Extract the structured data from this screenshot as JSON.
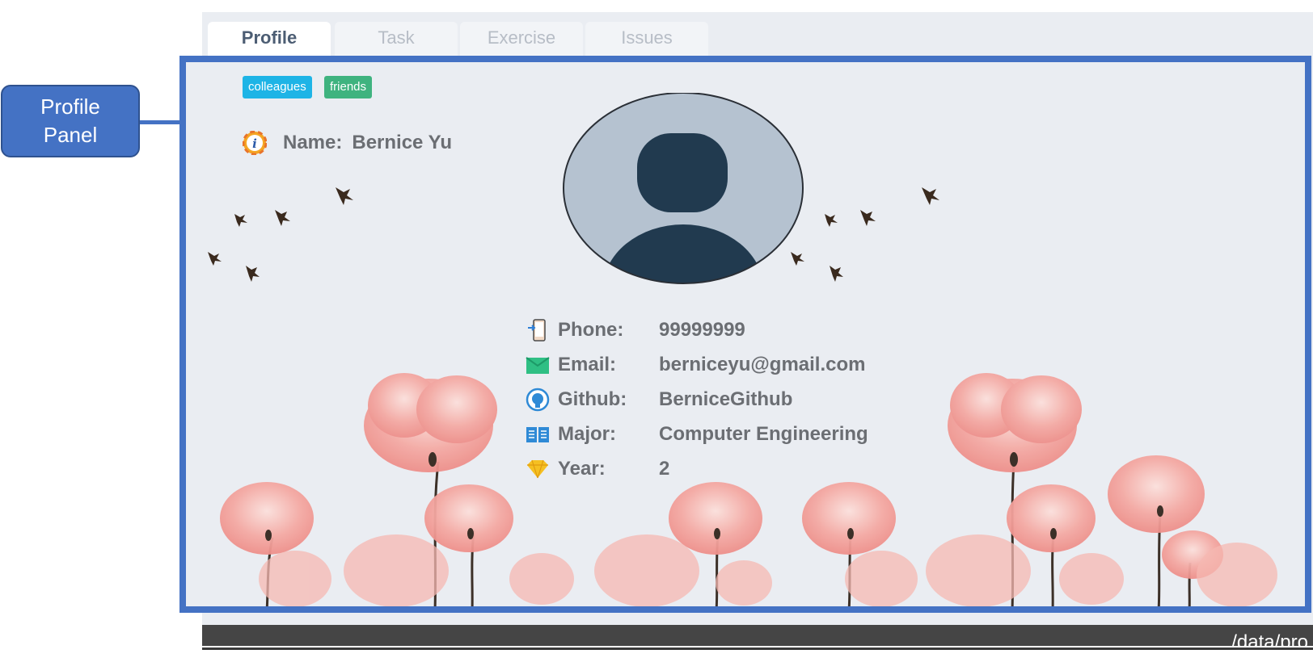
{
  "callout": {
    "line1": "Profile",
    "line2": "Panel"
  },
  "tabs": [
    {
      "label": "Profile",
      "active": true
    },
    {
      "label": "Task",
      "active": false
    },
    {
      "label": "Exercise",
      "active": false
    },
    {
      "label": "Issues",
      "active": false
    }
  ],
  "tags": [
    {
      "label": "colleagues",
      "color": "#1eb4e6"
    },
    {
      "label": "friends",
      "color": "#3fb37f"
    }
  ],
  "profile": {
    "name_label": "Name:",
    "name_value": "Bernice Yu",
    "fields": [
      {
        "icon": "phone-icon",
        "label": "Phone:",
        "value": "99999999"
      },
      {
        "icon": "email-icon",
        "label": "Email:",
        "value": "berniceyu@gmail.com"
      },
      {
        "icon": "github-icon",
        "label": "Github:",
        "value": "BerniceGithub"
      },
      {
        "icon": "book-icon",
        "label": "Major:",
        "value": "Computer Engineering"
      },
      {
        "icon": "diamond-icon",
        "label": "Year:",
        "value": "2"
      }
    ]
  },
  "status_bar": {
    "path": "./data/pro"
  },
  "colors": {
    "accent": "#4472c4",
    "background": "#eaedf2",
    "status_bar": "#454545"
  }
}
